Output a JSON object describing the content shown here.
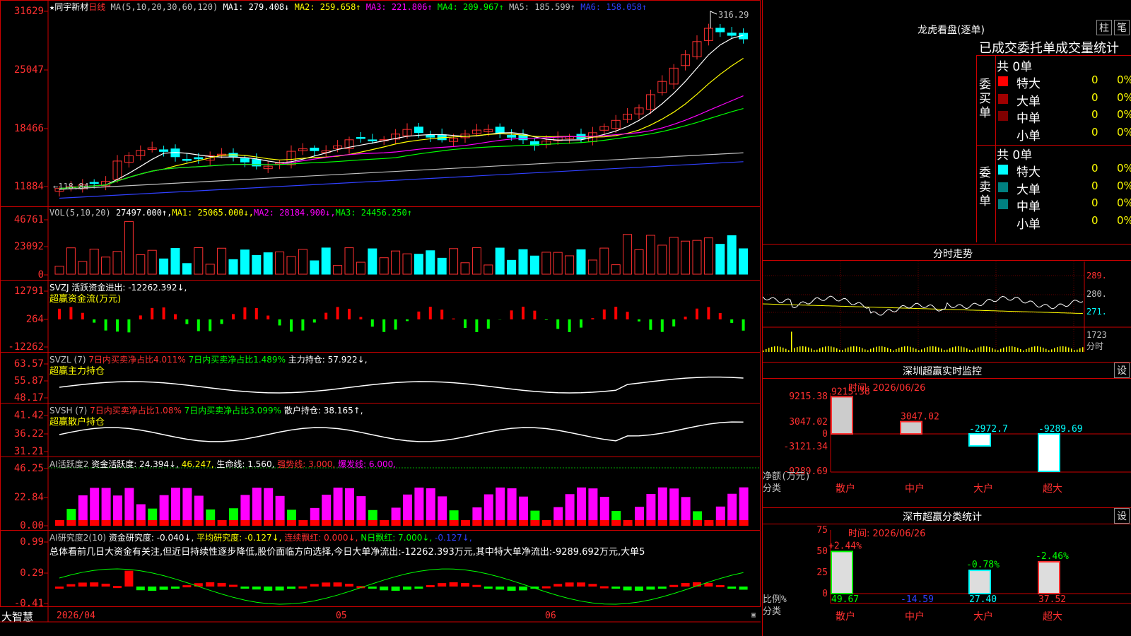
{
  "stock": {
    "name": "同宇新材",
    "period": "日线",
    "ma_params": "MA(5,10,20,30,60,120)",
    "ma_values": [
      {
        "label": "MA1:",
        "value": "279.408↓",
        "color": "#ffffff"
      },
      {
        "label": "MA2:",
        "value": "259.658↑",
        "color": "#ffff00"
      },
      {
        "label": "MA3:",
        "value": "221.806↑",
        "color": "#ff00ff"
      },
      {
        "label": "MA4:",
        "value": "209.967↑",
        "color": "#00ff00"
      },
      {
        "label": "MA5:",
        "value": "185.599↑",
        "color": "#c0c0c0"
      },
      {
        "label": "MA6:",
        "value": "158.058↑",
        "color": "#3040ff"
      }
    ],
    "high_mark": "316.29",
    "low_mark": "118.84"
  },
  "panels": {
    "price": {
      "yticks": [
        "31629",
        "25047",
        "18466",
        "11884"
      ]
    },
    "vol": {
      "header": "VOL(5,10,20)",
      "items": [
        {
          "text": "27497.000↑,",
          "color": "#ffffff"
        },
        {
          "text": "MA1: 25065.000↓,",
          "color": "#ffff00"
        },
        {
          "text": "MA2: 28184.900↓,",
          "color": "#ff00ff"
        },
        {
          "text": "MA3: 24456.250↑",
          "color": "#00ff00"
        }
      ],
      "yticks": [
        "46761",
        "23092",
        "0"
      ]
    },
    "svzj": {
      "line1": "SVZJ  活跃资金进出: -12262.392↓,",
      "line2": "超赢资金流(万元)",
      "yticks": [
        "12791",
        "264",
        "-12262"
      ]
    },
    "svzl": {
      "items": [
        {
          "text": "SVZL (7) ",
          "color": "#c0c0c0"
        },
        {
          "text": "7日内买卖净占比4.011%",
          "color": "#ff3030"
        },
        {
          "text": " 7日内买卖净占比1.489%",
          "color": "#00ff00"
        },
        {
          "text": " 主力持仓: 57.922↓,",
          "color": "#ffffff"
        }
      ],
      "line2": "超赢主力持仓",
      "yticks": [
        "63.57",
        "55.87",
        "48.17"
      ]
    },
    "svsh": {
      "items": [
        {
          "text": "SVSH (7) ",
          "color": "#c0c0c0"
        },
        {
          "text": "7日内买卖净占比1.08%",
          "color": "#ff3030"
        },
        {
          "text": " 7日内买卖净占比3.099%",
          "color": "#00ff00"
        },
        {
          "text": " 散户持仓: 38.165↑,",
          "color": "#ffffff"
        }
      ],
      "line2": "超赢散户持仓",
      "yticks": [
        "41.42",
        "36.22",
        "31.21"
      ]
    },
    "ai_active": {
      "items": [
        {
          "text": "AI活跃度2 ",
          "color": "#c0c0c0"
        },
        {
          "text": "资金活跃度: 24.394↓,",
          "color": "#ffffff"
        },
        {
          "text": " 46.247,",
          "color": "#ffff00"
        },
        {
          "text": " 生命线: 1.560,",
          "color": "#ffffff"
        },
        {
          "text": " 强势线: 3.000,",
          "color": "#ff3030"
        },
        {
          "text": " 爆发线: 6.000,",
          "color": "#ff00ff"
        }
      ],
      "yticks": [
        "46.25",
        "22.84",
        "0.00"
      ]
    },
    "ai_research": {
      "items": [
        {
          "text": "AI研究度2(10) ",
          "color": "#c0c0c0"
        },
        {
          "text": "资金研究度: -0.040↓,",
          "color": "#ffffff"
        },
        {
          "text": " 平均研究度: -0.127↓,",
          "color": "#ffff00"
        },
        {
          "text": " 连续飘红: 0.000↓,",
          "color": "#ff3030"
        },
        {
          "text": " N日飘红: 7.000↓,",
          "color": "#00ff00"
        },
        {
          "text": " -0.127↓,",
          "color": "#3040ff"
        }
      ],
      "summary": "总体看前几日大资金有关注,但近日持续性逐步降低,股价面临方向选择,今日大单净流出:-12262.393万元,其中特大单净流出:-9289.692万元,大单5",
      "yticks": [
        "0.99",
        "0.29",
        "-0.41"
      ]
    }
  },
  "date_axis": [
    "2026/04",
    "05",
    "06"
  ],
  "brand": "大智慧",
  "right": {
    "title": "龙虎看盘(逐单)",
    "btn_a": "柱",
    "btn_b": "笔",
    "stats_title": "已成交委托单成交量统计",
    "buy": {
      "label": "委买单",
      "total": "共 0单",
      "rows": [
        {
          "name": "特大",
          "val": "0",
          "pct": "0%",
          "color": "#ff0000"
        },
        {
          "name": "大单",
          "val": "0",
          "pct": "0%",
          "color": "#a00000"
        },
        {
          "name": "中单",
          "val": "0",
          "pct": "0%",
          "color": "#800000"
        },
        {
          "name": "小单",
          "val": "0",
          "pct": "0%",
          "color": ""
        }
      ]
    },
    "sell": {
      "label": "委卖单",
      "total": "共 0单",
      "rows": [
        {
          "name": "特大",
          "val": "0",
          "pct": "0%",
          "color": "#00ffff"
        },
        {
          "name": "大单",
          "val": "0",
          "pct": "0%",
          "color": "#008080"
        },
        {
          "name": "中单",
          "val": "0",
          "pct": "0%",
          "color": "#008080"
        },
        {
          "name": "小单",
          "val": "0",
          "pct": "0%",
          "color": ""
        }
      ]
    },
    "intraday": {
      "title": "分时走势",
      "yticks": [
        "289.",
        "280.",
        "271.",
        "1723",
        "分时"
      ]
    },
    "monitor": {
      "title": "深圳超赢实时监控",
      "settings": "设",
      "time": "时间: 2026/06/26",
      "yticks": [
        "9215.38",
        "3047.02",
        "0",
        "-3121.34",
        "-9289.69"
      ],
      "ylabel1": "净额(万元)",
      "ylabel2": "分类",
      "categories": [
        "散户",
        "中户",
        "大户",
        "超大"
      ],
      "values": [
        9215.38,
        3047.02,
        -2972.7,
        -9289.69
      ],
      "labels": [
        "9215.38",
        "3047.02",
        "-2972.7",
        "-9289.69"
      ]
    },
    "classify": {
      "title": "深市超赢分类统计",
      "settings": "设",
      "time": "时间: 2026/06/26",
      "yticks": [
        "75",
        "50",
        "25",
        "0"
      ],
      "ylabel1": "比例%",
      "ylabel2": "分类",
      "categories": [
        "散户",
        "中户",
        "大户",
        "超大"
      ],
      "top_labels": [
        "+2.44%",
        "",
        "-0.78%",
        "-2.46%"
      ],
      "bottom_labels": [
        "49.67",
        "-14.59",
        "27.40",
        "37.52"
      ],
      "values": [
        49.67,
        14.59,
        27.4,
        37.52
      ]
    }
  },
  "chart_data": [
    {
      "type": "bar",
      "title": "深圳超赢实时监控",
      "xlabel": "分类",
      "ylabel": "净额(万元)",
      "categories": [
        "散户",
        "中户",
        "大户",
        "超大"
      ],
      "values": [
        9215.38,
        3047.02,
        -2972.7,
        -9289.69
      ],
      "ylim": [
        -9289.69,
        9215.38
      ]
    },
    {
      "type": "bar",
      "title": "深市超赢分类统计",
      "xlabel": "分类",
      "ylabel": "比例%",
      "categories": [
        "散户",
        "中户",
        "大户",
        "超大"
      ],
      "values": [
        49.67,
        14.59,
        27.4,
        37.52
      ],
      "change": [
        "+2.44%",
        "",
        "-0.78%",
        "-2.46%"
      ],
      "ylim": [
        0,
        75
      ]
    }
  ]
}
